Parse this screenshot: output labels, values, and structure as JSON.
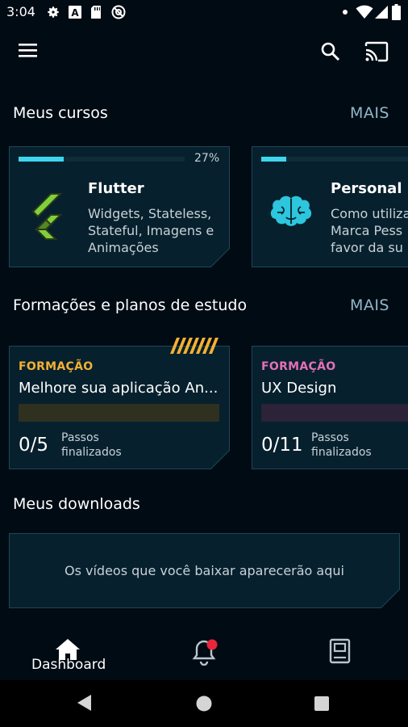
{
  "status_bar": {
    "time": "3:04",
    "left_icons": [
      "gear-icon",
      "a-box-icon",
      "sd-card-icon",
      "no-sync-icon"
    ],
    "right_icons": [
      "dot-icon",
      "wifi-icon",
      "signal-icon",
      "battery-icon"
    ]
  },
  "app_bar": {
    "menu_icon": "hamburger-menu-icon",
    "search_icon": "search-icon",
    "cast_icon": "cast-icon"
  },
  "courses": {
    "title": "Meus cursos",
    "more": "MAIS",
    "items": [
      {
        "progress_percent": 27,
        "progress_label": "27%",
        "title": "Flutter",
        "description": "Widgets, Stateless, Stateful, Imagens e Animações",
        "icon": "flutter-logo-icon"
      },
      {
        "progress_percent": 15,
        "progress_label": "",
        "title": "Personal B",
        "description": "Como utiliza Marca Pess favor da su",
        "icon": "brain-icon"
      }
    ]
  },
  "formations": {
    "title": "Formações e planos de estudo",
    "more": "MAIS",
    "items": [
      {
        "tag": "FORMAÇÃO",
        "title": "Melhore sua aplicação An...",
        "count": "0/5",
        "steps_line1": "Passos",
        "steps_line2": "finalizados",
        "tag_color": "#f2b134",
        "bar_color": "#2f301f"
      },
      {
        "tag": "FORMAÇÃO",
        "title": "UX Design",
        "count": "0/11",
        "steps_line1": "Passos",
        "steps_line2": "finalizados",
        "tag_color": "#e370b8",
        "bar_color": "#2c2338"
      }
    ]
  },
  "downloads": {
    "title": "Meus downloads",
    "empty_text": "Os vídeos que você baixar aparecerão aqui"
  },
  "bottom_nav": {
    "dashboard_label": "Dashboard",
    "home_icon": "home-icon",
    "notifications_icon": "bell-icon",
    "notifications_badge_color": "#e8263b",
    "library_icon": "book-icon"
  },
  "system_nav": {
    "back_icon": "back-triangle-icon",
    "home_icon": "home-circle-icon",
    "recents_icon": "recents-square-icon"
  },
  "colors": {
    "background": "#010b14",
    "card_background": "#07202d",
    "card_border": "#1d4657",
    "accent": "#3ed5ee",
    "more_text": "#8fb8c9"
  }
}
